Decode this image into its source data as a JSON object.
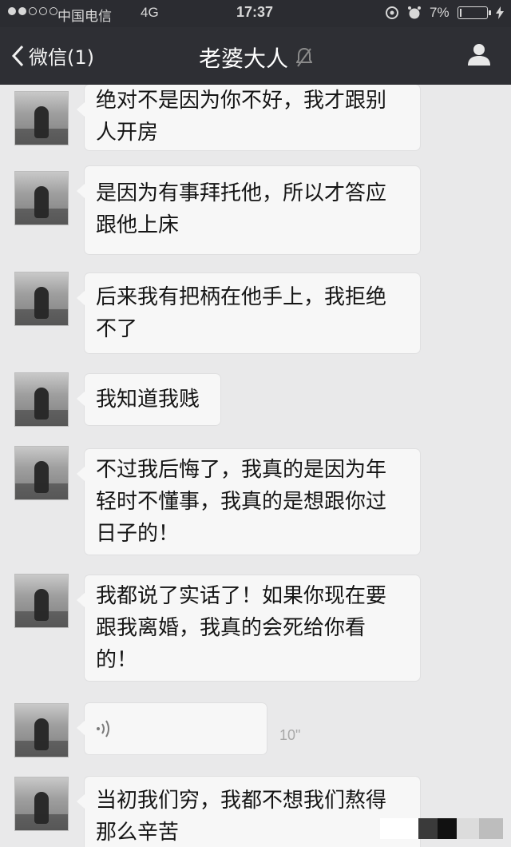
{
  "status_bar": {
    "carrier": "中国电信",
    "network": "4G",
    "time": "17:37",
    "battery": "7%",
    "battery_level": 0.07,
    "icons": [
      "signal-dots-icon",
      "location-icon",
      "alarm-icon",
      "battery-icon",
      "charging-icon"
    ]
  },
  "nav": {
    "back_label": "微信(1)",
    "title": "老婆大人",
    "title_icon": "mute-icon",
    "right_icon": "profile-icon",
    "bg_color": "#2e2f34"
  },
  "messages": [
    {
      "type": "text",
      "lines": [
        "绝对不是因为你不好，我才跟别",
        "人开房"
      ]
    },
    {
      "type": "text",
      "lines": [
        "是因为有事拜托他，所以才答应",
        "跟他上床"
      ]
    },
    {
      "type": "text",
      "lines": [
        "后来我有把柄在他手上，我拒绝",
        "不了"
      ]
    },
    {
      "type": "text",
      "lines": [
        "我知道我贱"
      ]
    },
    {
      "type": "text",
      "lines": [
        "不过我后悔了，我真的是因为年",
        "轻时不懂事，我真的是想跟你过",
        "日子的！"
      ]
    },
    {
      "type": "text",
      "lines": [
        "我都说了实话了！如果你现在要",
        "跟我离婚，我真的会死给你看",
        "的！"
      ]
    },
    {
      "type": "voice",
      "icon": "voice-wave-icon",
      "duration": "10\""
    },
    {
      "type": "text",
      "lines": [
        "当初我们穷，我都不想我们熬得",
        "那么辛苦"
      ]
    }
  ],
  "colors": {
    "chat_bg": "#e9e9ea",
    "bubble_bg": "#f7f7f7",
    "status_bg": "#2b2c31"
  }
}
